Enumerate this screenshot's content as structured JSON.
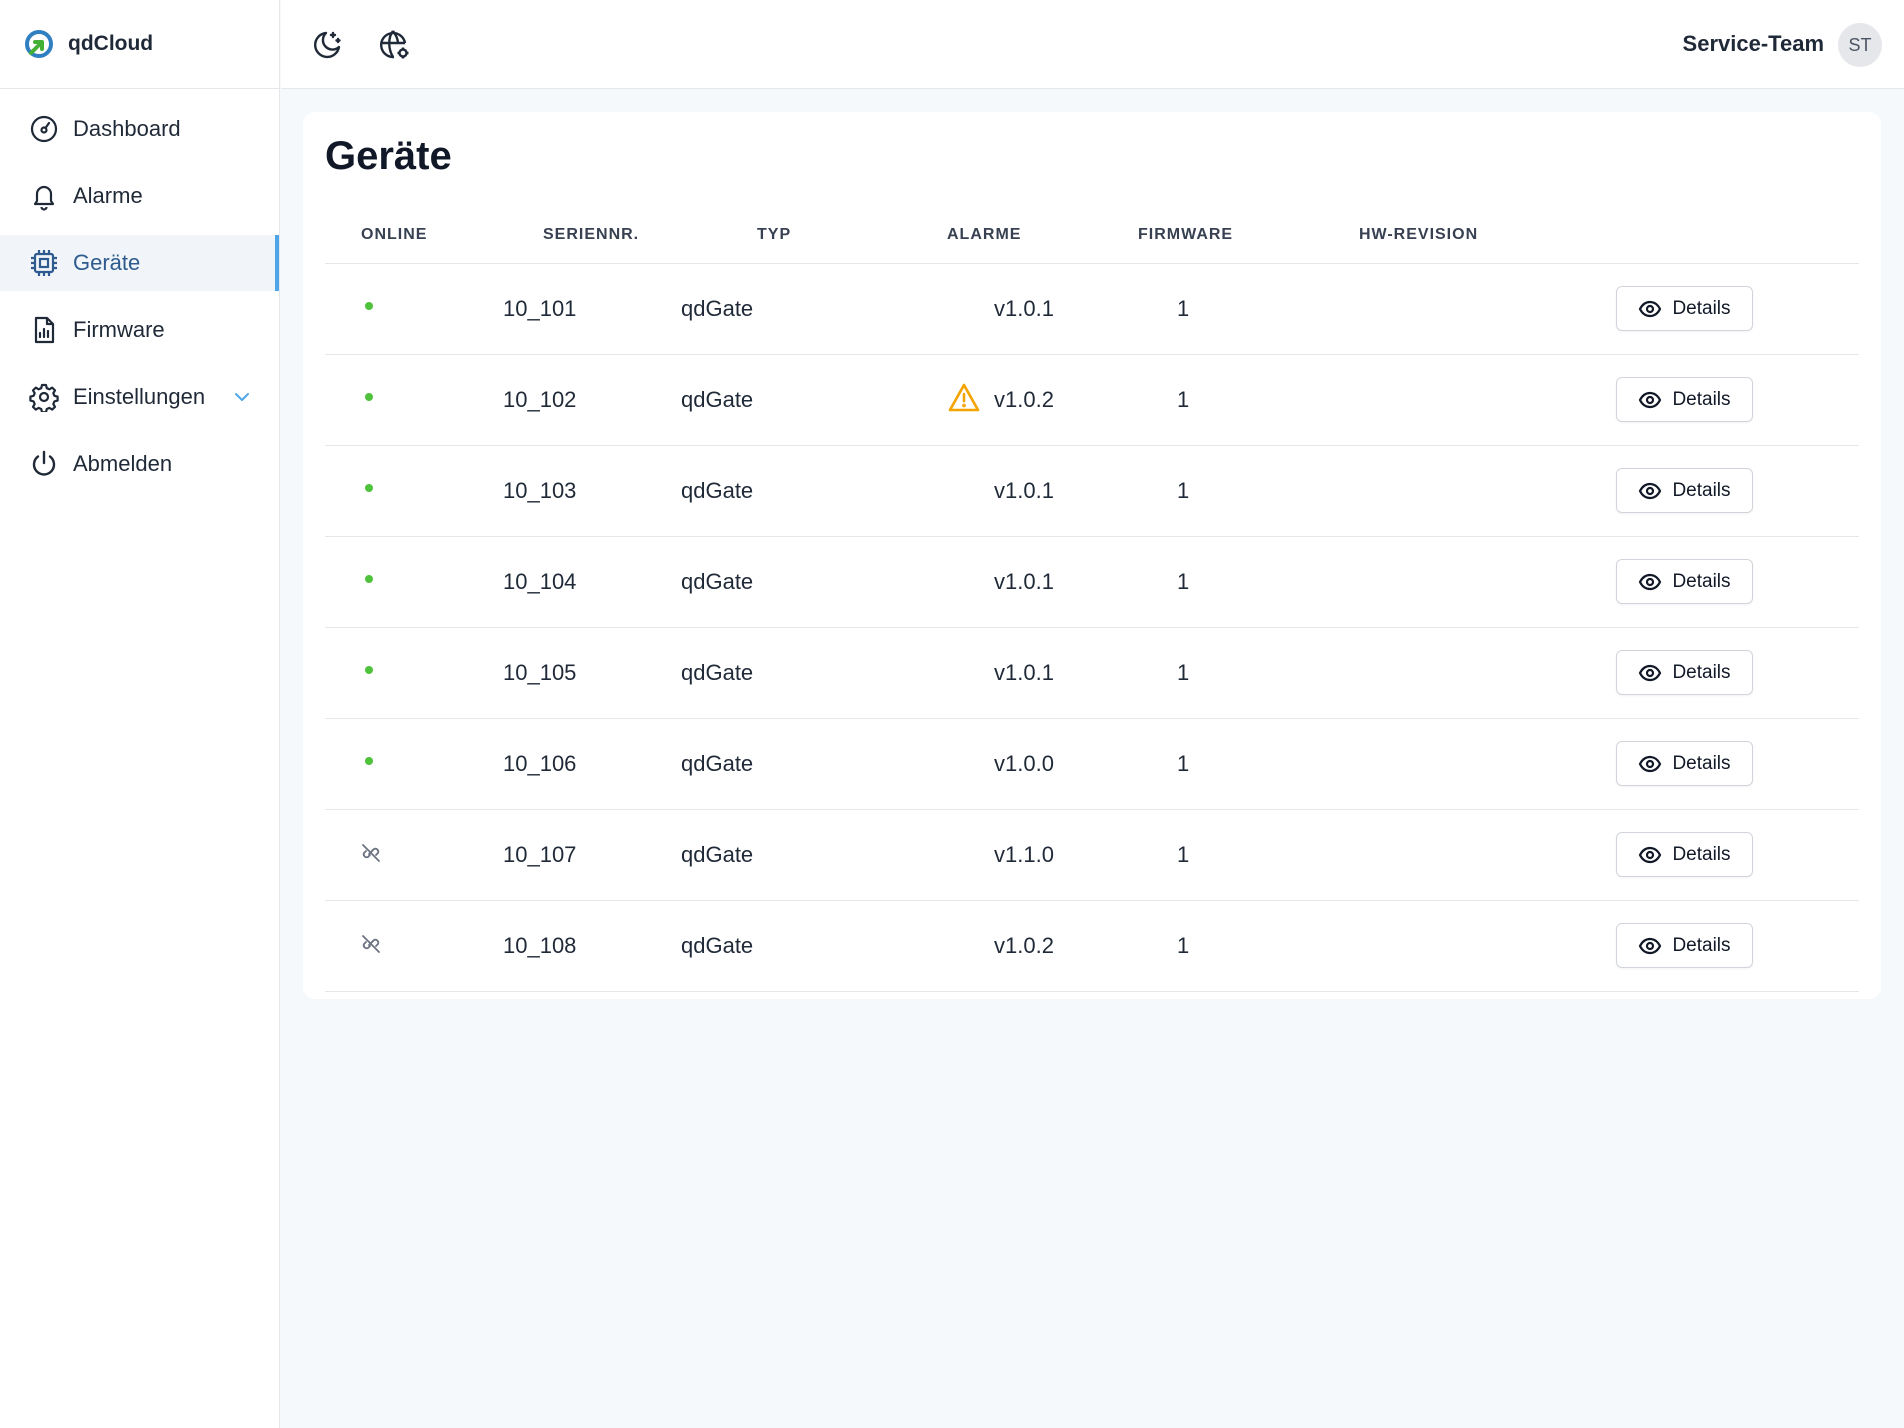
{
  "brand": {
    "name": "qdCloud"
  },
  "sidebar": {
    "items": [
      {
        "label": "Dashboard",
        "icon": "gauge-icon",
        "active": false
      },
      {
        "label": "Alarme",
        "icon": "bell-icon",
        "active": false
      },
      {
        "label": "Geräte",
        "icon": "chip-icon",
        "active": true
      },
      {
        "label": "Firmware",
        "icon": "file-chart-icon",
        "active": false
      },
      {
        "label": "Einstellungen",
        "icon": "gear-icon",
        "active": false,
        "expandable": true
      },
      {
        "label": "Abmelden",
        "icon": "power-icon",
        "active": false
      }
    ]
  },
  "topbar": {
    "theme_toggle_icon": "moon-stars-icon",
    "language_icon": "globe-icon",
    "user_name": "Service-Team",
    "avatar_initials": "ST"
  },
  "page": {
    "title": "Geräte"
  },
  "table": {
    "columns": [
      "ONLINE",
      "SERIENNR.",
      "TYP",
      "ALARME",
      "FIRMWARE",
      "HW-REVISION"
    ],
    "details_label": "Details",
    "rows": [
      {
        "online": true,
        "serial": "10_101",
        "type": "qdGate",
        "alarm": false,
        "firmware": "v1.0.1",
        "hw_revision": "1"
      },
      {
        "online": true,
        "serial": "10_102",
        "type": "qdGate",
        "alarm": true,
        "firmware": "v1.0.2",
        "hw_revision": "1"
      },
      {
        "online": true,
        "serial": "10_103",
        "type": "qdGate",
        "alarm": false,
        "firmware": "v1.0.1",
        "hw_revision": "1"
      },
      {
        "online": true,
        "serial": "10_104",
        "type": "qdGate",
        "alarm": false,
        "firmware": "v1.0.1",
        "hw_revision": "1"
      },
      {
        "online": true,
        "serial": "10_105",
        "type": "qdGate",
        "alarm": false,
        "firmware": "v1.0.1",
        "hw_revision": "1"
      },
      {
        "online": true,
        "serial": "10_106",
        "type": "qdGate",
        "alarm": false,
        "firmware": "v1.0.0",
        "hw_revision": "1"
      },
      {
        "online": false,
        "serial": "10_107",
        "type": "qdGate",
        "alarm": false,
        "firmware": "v1.1.0",
        "hw_revision": "1"
      },
      {
        "online": false,
        "serial": "10_108",
        "type": "qdGate",
        "alarm": false,
        "firmware": "v1.0.2",
        "hw_revision": "1"
      }
    ]
  },
  "colors": {
    "accent": "#4ea6e8",
    "active_text": "#2d5b8f",
    "online": "#4fc23c",
    "warning": "#f5a300",
    "offline": "#6b7280"
  }
}
